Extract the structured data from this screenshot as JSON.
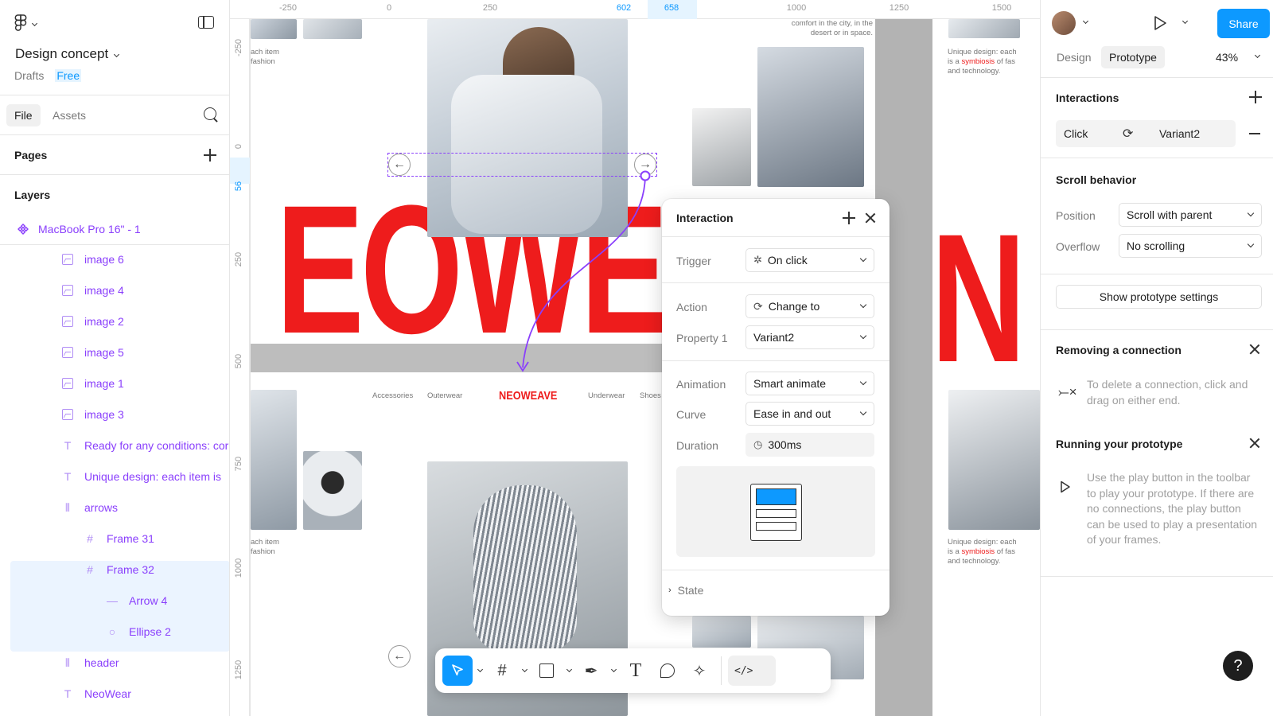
{
  "left_panel": {
    "file_name": "Design concept",
    "drafts_label": "Drafts",
    "plan_badge": "Free",
    "tabs": [
      "File",
      "Assets"
    ],
    "pages_label": "Pages",
    "layers_label": "Layers",
    "root_frame": "MacBook Pro 16\" - 1",
    "layers": [
      {
        "name": "image 6",
        "icon": "image-icon"
      },
      {
        "name": "image 4",
        "icon": "image-icon"
      },
      {
        "name": "image 2",
        "icon": "image-icon"
      },
      {
        "name": "image 5",
        "icon": "image-icon"
      },
      {
        "name": "image 1",
        "icon": "image-icon"
      },
      {
        "name": "image 3",
        "icon": "image-icon"
      },
      {
        "name": "Ready for any conditions: cor",
        "icon": "text-icon"
      },
      {
        "name": "Unique design: each item  is",
        "icon": "text-icon"
      },
      {
        "name": "arrows",
        "icon": "autolayout-icon"
      },
      {
        "name": "Frame 31",
        "icon": "frame-icon"
      },
      {
        "name": "Frame 32",
        "icon": "frame-icon"
      },
      {
        "name": "Arrow 4",
        "icon": "line-icon"
      },
      {
        "name": "Ellipse 2",
        "icon": "ellipse-icon"
      },
      {
        "name": "header",
        "icon": "autolayout-icon"
      },
      {
        "name": "NeoWear",
        "icon": "text-icon"
      }
    ]
  },
  "canvas": {
    "ruler_top": [
      "-250",
      "0",
      "250",
      "602",
      "658",
      "1000",
      "1250",
      "1500"
    ],
    "ruler_left": [
      "-250",
      "0",
      "56",
      "250",
      "500",
      "750",
      "1000",
      "1250"
    ],
    "big_text": "EOWE",
    "big_text_right": "N",
    "caption_top_left": "ach item\nfashion",
    "caption_top_mid": "comfort in the city, in the\ndesert or in space.",
    "caption_right_pre": "Unique design: each",
    "caption_right_mid1": "is a ",
    "caption_right_red": "symbiosis",
    "caption_right_mid2": " of fas",
    "caption_right_post": "and technology.",
    "nav": [
      "Accessories",
      "Outerwear",
      "Underwear",
      "Shoes"
    ],
    "brand": "NEOWEAVE",
    "caption_bottom_left": "ach item\nfashion"
  },
  "interaction_popup": {
    "title": "Interaction",
    "trigger_label": "Trigger",
    "trigger_value": "On click",
    "action_label": "Action",
    "action_value": "Change to",
    "property_label": "Property 1",
    "property_value": "Variant2",
    "animation_label": "Animation",
    "animation_value": "Smart animate",
    "curve_label": "Curve",
    "curve_value": "Ease in and out",
    "duration_label": "Duration",
    "duration_value": "300ms",
    "state_label": "State"
  },
  "toolbar": {
    "tools": [
      "move-tool",
      "frame-tool",
      "shape-tool",
      "pen-tool",
      "text-tool",
      "comment-tool",
      "actions-tool",
      "dev-mode-toggle"
    ]
  },
  "right_panel": {
    "share_label": "Share",
    "tabs": [
      "Design",
      "Prototype"
    ],
    "zoom": "43%",
    "interactions_title": "Interactions",
    "interaction_trigger": "Click",
    "interaction_target": "Variant2",
    "scroll_title": "Scroll behavior",
    "position_label": "Position",
    "position_value": "Scroll with parent",
    "overflow_label": "Overflow",
    "overflow_value": "No scrolling",
    "settings_button": "Show prototype settings",
    "removing_title": "Removing a connection",
    "removing_text": "To delete a connection, click and drag on either end.",
    "running_title": "Running your prototype",
    "running_text": "Use the play button in the toolbar to play your prototype. If there are no connections, the play button can be used to play a presentation of your frames.",
    "help_label": "?"
  },
  "colors": {
    "accent": "#0d99ff",
    "component": "#8a3ffc",
    "brand_red": "#ee1c1c"
  }
}
